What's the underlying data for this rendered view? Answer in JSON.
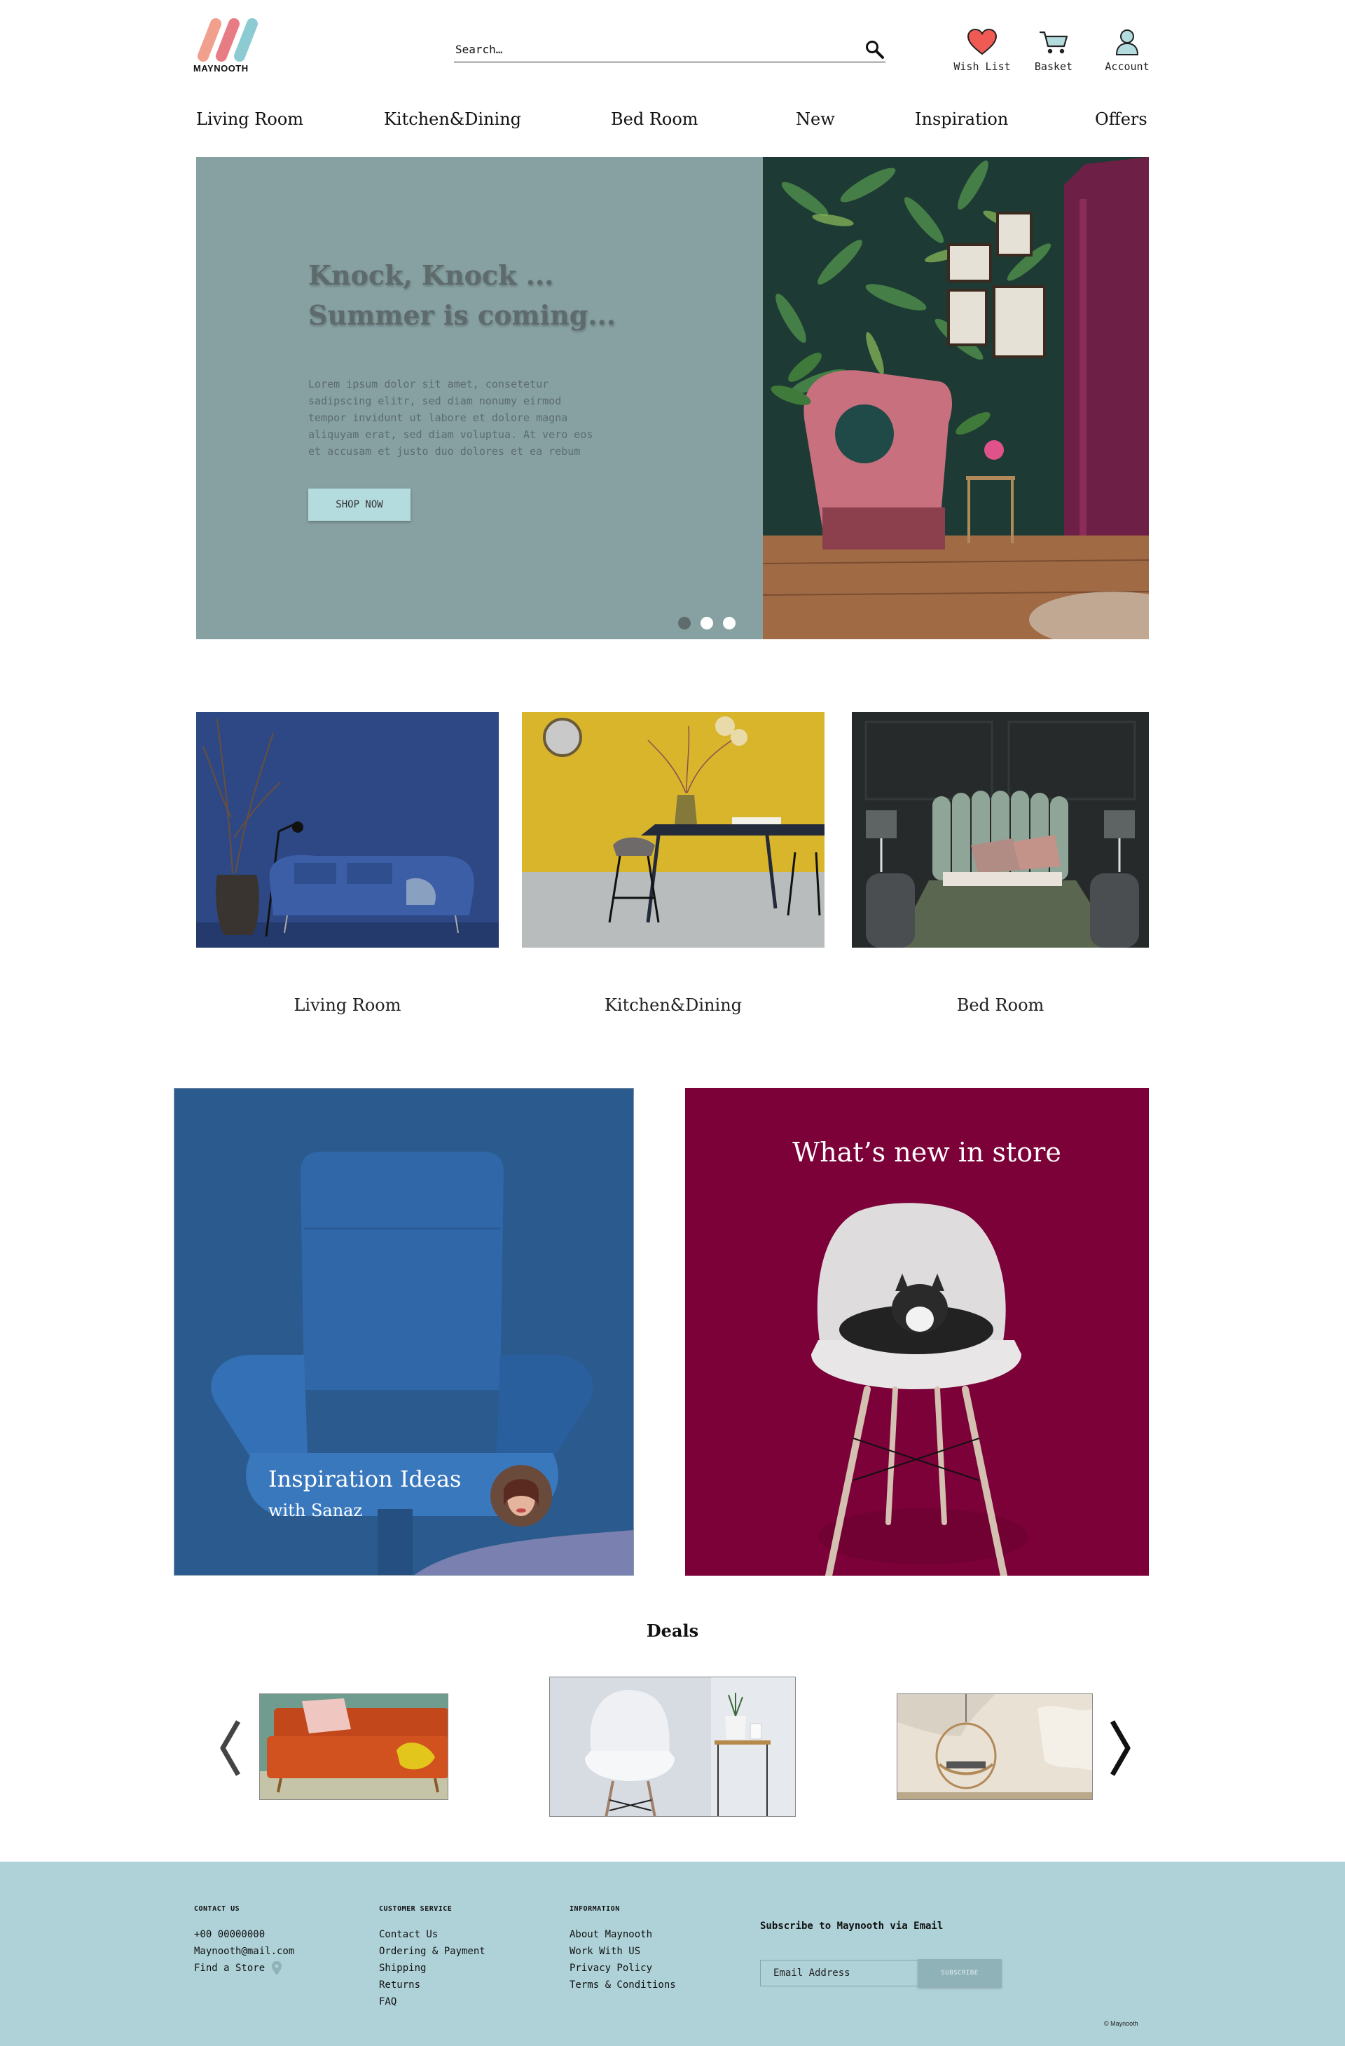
{
  "brand": {
    "name": "MAYNOOTH"
  },
  "search": {
    "placeholder": "Search…"
  },
  "header_actions": [
    {
      "label": "Wish List",
      "icon": "heart-icon"
    },
    {
      "label": "Basket",
      "icon": "cart-icon"
    },
    {
      "label": "Account",
      "icon": "user-icon"
    }
  ],
  "nav": [
    "Living Room",
    "Kitchen&Dining",
    "Bed Room",
    "New",
    "Inspiration",
    "Offers"
  ],
  "hero": {
    "title_line1": "Knock, Knock ...",
    "title_line2": "Summer is coming...",
    "body_lines": [
      "Lorem ipsum dolor sit amet, consetetur",
      "sadipscing elitr, sed diam nonumy eirmod",
      "tempor invidunt ut labore et dolore magna",
      "aliquyam erat, sed diam voluptua. At vero eos",
      "et accusam et justo duo dolores et ea rebum"
    ],
    "cta": "SHOP NOW",
    "slides": 3,
    "active_slide": 1
  },
  "categories": [
    "Living Room",
    "Kitchen&Dining",
    "Bed Room"
  ],
  "promos": {
    "inspiration": {
      "title": "Inspiration Ideas",
      "subtitle": "with Sanaz"
    },
    "new_store": {
      "title": "What’s new in store"
    }
  },
  "deals": {
    "title": "Deals"
  },
  "footer": {
    "contact": {
      "heading": "CONTACT US",
      "phone": "+00 00000000",
      "email": "Maynooth@mail.com",
      "store": "Find a Store"
    },
    "service": {
      "heading": "CUSTOMER SERVICE",
      "links": [
        "Contact Us",
        "Ordering & Payment",
        "Shipping",
        "Returns",
        "FAQ"
      ]
    },
    "info": {
      "heading": "INFORMATION",
      "links": [
        "About Maynooth",
        "Work With US",
        "Privacy Policy",
        "Terms & Conditions"
      ]
    },
    "subscribe": {
      "title": "Subscribe to Maynooth via Email",
      "placeholder": "Email Address",
      "button": "SUBSCRIBE"
    },
    "copyright": "© Maynooth"
  },
  "colors": {
    "hero_bg": "#87a0a2",
    "inspiration_bg": "#2b5b8e",
    "new_store_bg": "#7c0138",
    "footer_bg": "#afd2d9",
    "accent": "#b4dbde"
  }
}
